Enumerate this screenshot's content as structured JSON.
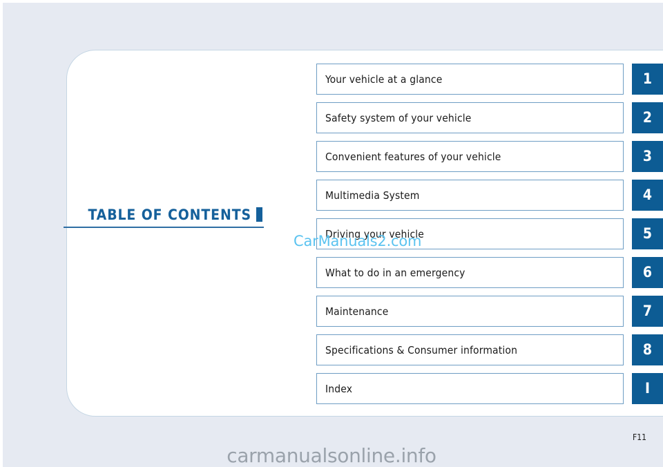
{
  "document": {
    "title": "TABLE OF CONTENTS",
    "page_number": "F11"
  },
  "colors": {
    "paper_background": "#e6eaf2",
    "card_background": "#ffffff",
    "card_border": "#c5d6e4",
    "accent_blue": "#0d5c94",
    "title_blue": "#15609b",
    "box_border": "#6e9dc4",
    "rule_blue": "#2e6ea3",
    "watermark_inline": "#5bc3f0",
    "watermark_footer": "#9aa2ab"
  },
  "toc": {
    "entries": [
      {
        "label": "Your vehicle at a glance",
        "tab": "1"
      },
      {
        "label": "Safety system of your vehicle",
        "tab": "2"
      },
      {
        "label": "Convenient features of your vehicle",
        "tab": "3"
      },
      {
        "label": "Multimedia System",
        "tab": "4"
      },
      {
        "label": "Driving your vehicle",
        "tab": "5"
      },
      {
        "label": "What to do in an emergency",
        "tab": "6"
      },
      {
        "label": "Maintenance",
        "tab": "7"
      },
      {
        "label": "Specifications & Consumer information",
        "tab": "8"
      },
      {
        "label": "Index",
        "tab": "I"
      }
    ]
  },
  "watermarks": {
    "inline": "CarManuals2.com",
    "footer": "carmanualsonline.info"
  }
}
